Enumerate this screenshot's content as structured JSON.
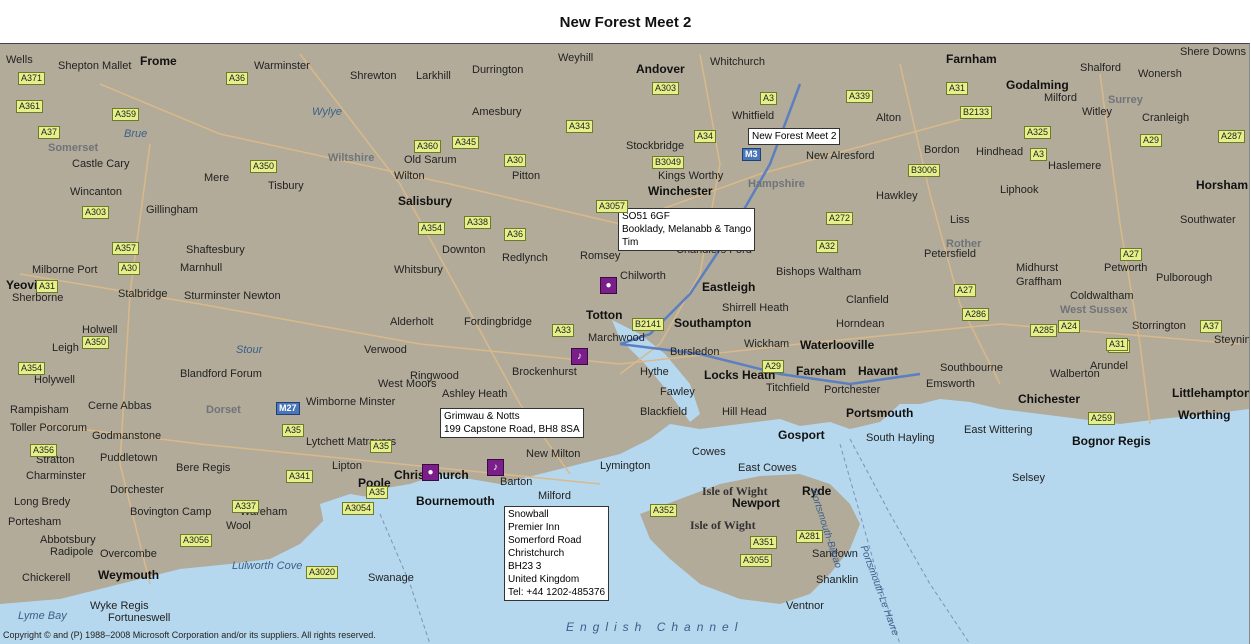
{
  "title": "New Forest Meet 2",
  "places": [
    {
      "name": "Frome",
      "kind": "major"
    },
    {
      "name": "Andover",
      "kind": "major"
    },
    {
      "name": "Farnham",
      "kind": "major"
    },
    {
      "name": "Wells",
      "kind": "town"
    },
    {
      "name": "Shepton Mallet",
      "kind": "town"
    },
    {
      "name": "Warminster",
      "kind": "town"
    },
    {
      "name": "Shrewton",
      "kind": "town"
    },
    {
      "name": "Larkhill",
      "kind": "town"
    },
    {
      "name": "Durrington",
      "kind": "town"
    },
    {
      "name": "Weyhill",
      "kind": "town"
    },
    {
      "name": "Whitchurch",
      "kind": "town"
    },
    {
      "name": "Shere Downs",
      "kind": "town"
    },
    {
      "name": "Godalming",
      "kind": "major"
    },
    {
      "name": "Milford",
      "kind": "town"
    },
    {
      "name": "Shalford",
      "kind": "town"
    },
    {
      "name": "Wonersh",
      "kind": "town"
    },
    {
      "name": "Amesbury",
      "kind": "town"
    },
    {
      "name": "Whitfield",
      "kind": "town"
    },
    {
      "name": "Alton",
      "kind": "town"
    },
    {
      "name": "Witley",
      "kind": "town"
    },
    {
      "name": "Cranleigh",
      "kind": "town"
    },
    {
      "name": "Castle Cary",
      "kind": "town"
    },
    {
      "name": "Old Sarum",
      "kind": "town"
    },
    {
      "name": "Stockbridge",
      "kind": "town"
    },
    {
      "name": "New Alresford",
      "kind": "town"
    },
    {
      "name": "Bordon",
      "kind": "town"
    },
    {
      "name": "Hindhead",
      "kind": "town"
    },
    {
      "name": "Haslemere",
      "kind": "town"
    },
    {
      "name": "Mere",
      "kind": "town"
    },
    {
      "name": "Wilton",
      "kind": "town"
    },
    {
      "name": "Pitton",
      "kind": "town"
    },
    {
      "name": "Kings Worthy",
      "kind": "town"
    },
    {
      "name": "Wincanton",
      "kind": "town"
    },
    {
      "name": "Tisbury",
      "kind": "town"
    },
    {
      "name": "Winchester",
      "kind": "major"
    },
    {
      "name": "Hawkley",
      "kind": "town"
    },
    {
      "name": "Liphook",
      "kind": "town"
    },
    {
      "name": "Horsham",
      "kind": "major"
    },
    {
      "name": "Salisbury",
      "kind": "major"
    },
    {
      "name": "Gillingham",
      "kind": "town"
    },
    {
      "name": "Southwater",
      "kind": "town"
    },
    {
      "name": "Liss",
      "kind": "town"
    },
    {
      "name": "Shaftesbury",
      "kind": "town"
    },
    {
      "name": "Downton",
      "kind": "town"
    },
    {
      "name": "Romsey",
      "kind": "town"
    },
    {
      "name": "Chandlers Ford",
      "kind": "town"
    },
    {
      "name": "Petersfield",
      "kind": "town"
    },
    {
      "name": "Milborne Port",
      "kind": "town"
    },
    {
      "name": "Marnhull",
      "kind": "town"
    },
    {
      "name": "Whitsbury",
      "kind": "town"
    },
    {
      "name": "Redlynch",
      "kind": "town"
    },
    {
      "name": "Chilworth",
      "kind": "town"
    },
    {
      "name": "Bishops Waltham",
      "kind": "town"
    },
    {
      "name": "Midhurst",
      "kind": "town"
    },
    {
      "name": "Petworth",
      "kind": "town"
    },
    {
      "name": "Pulborough",
      "kind": "town"
    },
    {
      "name": "Yeovil",
      "kind": "major"
    },
    {
      "name": "Sherborne",
      "kind": "town"
    },
    {
      "name": "Stalbridge",
      "kind": "town"
    },
    {
      "name": "Sturminster Newton",
      "kind": "town"
    },
    {
      "name": "Eastleigh",
      "kind": "major"
    },
    {
      "name": "Graffham",
      "kind": "town"
    },
    {
      "name": "Coldwaltham",
      "kind": "town"
    },
    {
      "name": "Clanfield",
      "kind": "town"
    },
    {
      "name": "Totton",
      "kind": "major"
    },
    {
      "name": "Alderholt",
      "kind": "town"
    },
    {
      "name": "Fordingbridge",
      "kind": "town"
    },
    {
      "name": "Southampton",
      "kind": "major"
    },
    {
      "name": "Shirrell Heath",
      "kind": "town"
    },
    {
      "name": "Horndean",
      "kind": "town"
    },
    {
      "name": "Storrington",
      "kind": "town"
    },
    {
      "name": "Holwell",
      "kind": "town"
    },
    {
      "name": "Marchwood",
      "kind": "town"
    },
    {
      "name": "Leigh",
      "kind": "town"
    },
    {
      "name": "Verwood",
      "kind": "town"
    },
    {
      "name": "Bursledon",
      "kind": "town"
    },
    {
      "name": "Wickham",
      "kind": "town"
    },
    {
      "name": "Waterlooville",
      "kind": "major"
    },
    {
      "name": "Steyning",
      "kind": "town"
    },
    {
      "name": "Southbourne",
      "kind": "town"
    },
    {
      "name": "Arundel",
      "kind": "town"
    },
    {
      "name": "Hythe",
      "kind": "town"
    },
    {
      "name": "Fareham",
      "kind": "major"
    },
    {
      "name": "Havant",
      "kind": "major"
    },
    {
      "name": "Holywell",
      "kind": "town"
    },
    {
      "name": "Blandford Forum",
      "kind": "town"
    },
    {
      "name": "Ringwood",
      "kind": "town"
    },
    {
      "name": "Locks Heath",
      "kind": "major"
    },
    {
      "name": "Walberton",
      "kind": "town"
    },
    {
      "name": "Littlehampton",
      "kind": "major"
    },
    {
      "name": "West Moors",
      "kind": "town"
    },
    {
      "name": "Fawley",
      "kind": "town"
    },
    {
      "name": "Titchfield",
      "kind": "town"
    },
    {
      "name": "Portchester",
      "kind": "town"
    },
    {
      "name": "Emsworth",
      "kind": "town"
    },
    {
      "name": "Chichester",
      "kind": "major"
    },
    {
      "name": "Cerne Abbas",
      "kind": "town"
    },
    {
      "name": "Ashley Heath",
      "kind": "town"
    },
    {
      "name": "Brockenhurst",
      "kind": "town"
    },
    {
      "name": "Rampisham",
      "kind": "town"
    },
    {
      "name": "Wimborne Minster",
      "kind": "town"
    },
    {
      "name": "Blackfield",
      "kind": "town"
    },
    {
      "name": "Hill Head",
      "kind": "town"
    },
    {
      "name": "Portsmouth",
      "kind": "major"
    },
    {
      "name": "Worthing",
      "kind": "major"
    },
    {
      "name": "Toller Porcorum",
      "kind": "town"
    },
    {
      "name": "Godmanstone",
      "kind": "town"
    },
    {
      "name": "Gosport",
      "kind": "major"
    },
    {
      "name": "South Hayling",
      "kind": "town"
    },
    {
      "name": "East Wittering",
      "kind": "town"
    },
    {
      "name": "Bognor Regis",
      "kind": "major"
    },
    {
      "name": "Lytchett Matravers",
      "kind": "town"
    },
    {
      "name": "Puddletown",
      "kind": "town"
    },
    {
      "name": "Stratton",
      "kind": "town"
    },
    {
      "name": "Cowes",
      "kind": "town"
    },
    {
      "name": "New Milton",
      "kind": "town"
    },
    {
      "name": "Bere Regis",
      "kind": "town"
    },
    {
      "name": "Lipton",
      "kind": "town"
    },
    {
      "name": "Lymington",
      "kind": "town"
    },
    {
      "name": "East Cowes",
      "kind": "town"
    },
    {
      "name": "Christchurch",
      "kind": "major"
    },
    {
      "name": "Charminster",
      "kind": "town"
    },
    {
      "name": "Poole",
      "kind": "major"
    },
    {
      "name": "Dorchester",
      "kind": "town"
    },
    {
      "name": "Barton",
      "kind": "town"
    },
    {
      "name": "Ryde",
      "kind": "major"
    },
    {
      "name": "Selsey",
      "kind": "town"
    },
    {
      "name": "Long Bredy",
      "kind": "town"
    },
    {
      "name": "Bournemouth",
      "kind": "major"
    },
    {
      "name": "Milford",
      "kind": "town"
    },
    {
      "name": "Newport",
      "kind": "major"
    },
    {
      "name": "Bovington Camp",
      "kind": "town"
    },
    {
      "name": "Wareham",
      "kind": "town"
    },
    {
      "name": "Portesham",
      "kind": "town"
    },
    {
      "name": "Wool",
      "kind": "town"
    },
    {
      "name": "Abbotsbury",
      "kind": "town"
    },
    {
      "name": "Radipole",
      "kind": "town"
    },
    {
      "name": "Overcombe",
      "kind": "town"
    },
    {
      "name": "Sandown",
      "kind": "town"
    },
    {
      "name": "Chickerell",
      "kind": "town"
    },
    {
      "name": "Weymouth",
      "kind": "major"
    },
    {
      "name": "Swanage",
      "kind": "town"
    },
    {
      "name": "Shanklin",
      "kind": "town"
    },
    {
      "name": "Wyke Regis",
      "kind": "town"
    },
    {
      "name": "Fortuneswell",
      "kind": "town"
    },
    {
      "name": "Ventnor",
      "kind": "town"
    }
  ],
  "regions": [
    "Somerset",
    "Wiltshire",
    "Hampshire",
    "Surrey",
    "Dorset",
    "West Sussex",
    "Rother"
  ],
  "water": [
    "Brue",
    "Wylye",
    "Stour",
    "Lulworth Cove",
    "Lyme Bay",
    "English Channel"
  ],
  "islands": [
    "Isle of Wight",
    "Isle of Wight"
  ],
  "shipping_labels": [
    "Portsmouth-Bilbao",
    "Portsmouth-Le Havre"
  ],
  "roads": [
    "A371",
    "A36",
    "A303",
    "A3",
    "A339",
    "A31",
    "A361",
    "A359",
    "A343",
    "A34",
    "A3057",
    "A37",
    "A360",
    "A345",
    "M3",
    "A3",
    "A350",
    "A30",
    "B3049",
    "B3006",
    "A303",
    "A338",
    "A354",
    "A272",
    "A36",
    "A27",
    "A32",
    "A357",
    "A30",
    "A27",
    "A31",
    "A33",
    "B2141",
    "A286",
    "A285",
    "A24",
    "A37",
    "A354",
    "A350",
    "M27",
    "A29",
    "A27",
    "A31",
    "A35",
    "A341",
    "A35",
    "A259",
    "A356",
    "A35",
    "A337",
    "A3054",
    "A352",
    "A3056",
    "A351",
    "A3020",
    "A3055",
    "A281",
    "A29",
    "A287",
    "A325",
    "B2133"
  ],
  "markers": [
    {
      "label": "New Forest Meet 2"
    },
    {
      "lines": [
        "SO51 6GF",
        "Booklady, Melanabb & Tango",
        "Tim"
      ],
      "icon": "car"
    },
    {
      "lines": [
        "Grimwau & Notts",
        "199 Capstone Road, BH8 8SA"
      ],
      "icon": "car"
    },
    {
      "lines": [
        "Snowball",
        "Premier Inn",
        "Somerford Road",
        "Christchurch",
        "BH23 3",
        "United Kingdom",
        "Tel: +44 1202-485376"
      ],
      "icon": "restaurant"
    }
  ],
  "pins": [
    "car-marker",
    "car-marker",
    "restaurant-marker",
    "restaurant-marker"
  ],
  "copyright": "Copyright © and (P) 1988–2008 Microsoft Corporation and/or its suppliers. All rights reserved.",
  "colors": {
    "land": "#b2ab9a",
    "sea": "#b6d8ee",
    "road_a": "#e6f08a",
    "motorway": "#4a76b8",
    "marker": "#7a1f8a"
  }
}
